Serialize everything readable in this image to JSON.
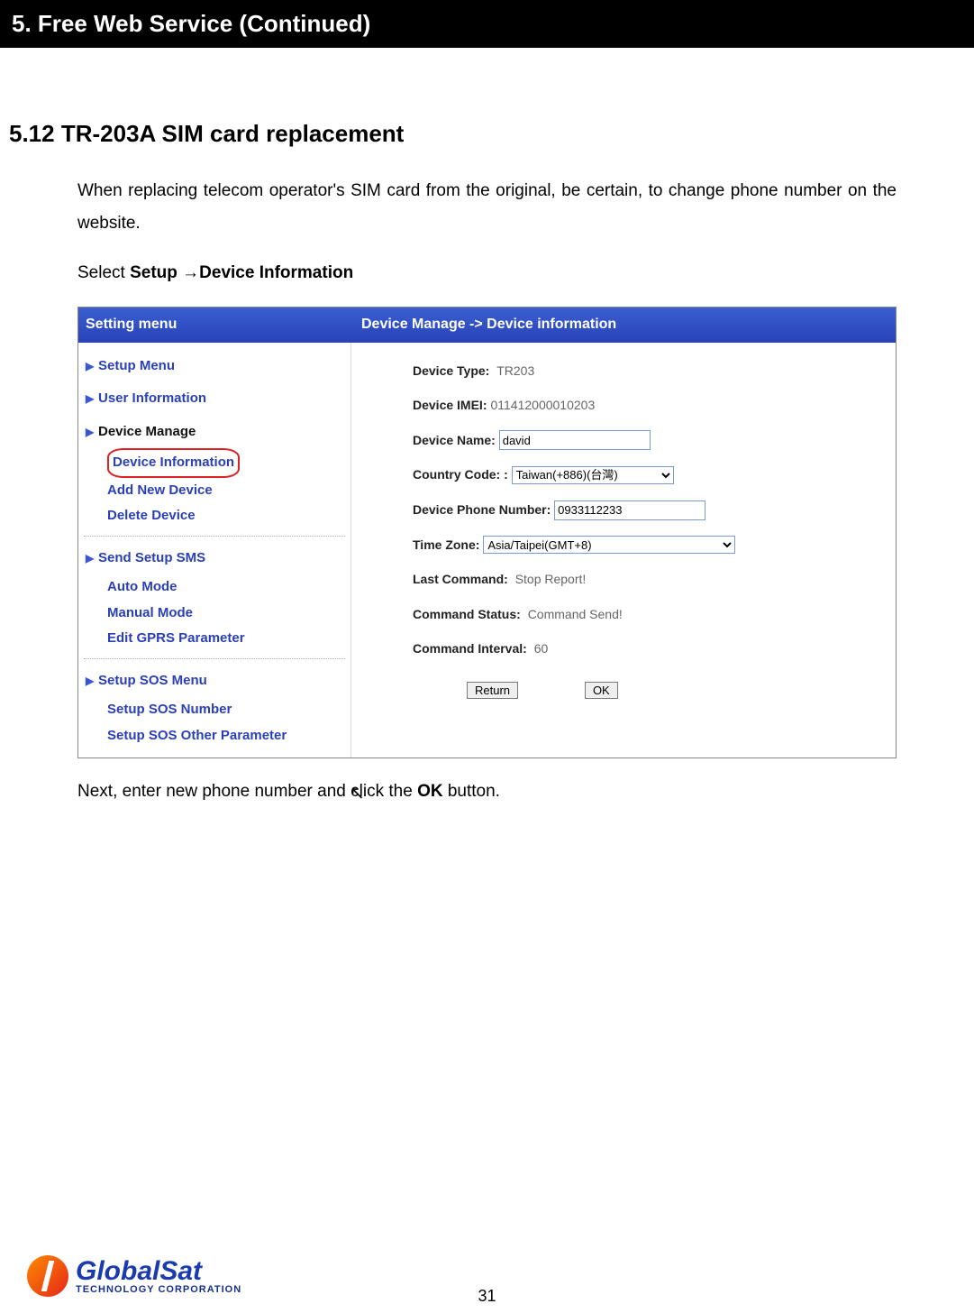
{
  "banner": "5. Free Web Service (Continued)",
  "heading": "5.12 TR-203A SIM card replacement",
  "para1": "When replacing telecom operator's SIM card from the original, be certain, to change phone number on the website.",
  "select_prefix": "Select ",
  "select_bold1": "Setup ",
  "select_arrow": "→",
  "select_bold2": "Device Information",
  "after_para_prefix": "Next, enter new phone number and click the ",
  "after_para_bold": "OK",
  "after_para_suffix": " button.",
  "bluebar_left": "Setting menu",
  "bluebar_right": "Device Manage -> Device information",
  "sidebar": {
    "setup_menu": "Setup Menu",
    "user_info": "User Information",
    "device_manage": "Device Manage",
    "device_info": "Device Information",
    "add_new_device": "Add New Device",
    "delete_device": "Delete Device",
    "send_setup_sms": "Send Setup SMS",
    "auto_mode": "Auto Mode",
    "manual_mode": "Manual Mode",
    "edit_gprs": "Edit GPRS Parameter",
    "setup_sos_menu": "Setup SOS Menu",
    "setup_sos_number": "Setup SOS Number",
    "setup_sos_other": "Setup SOS Other Parameter"
  },
  "form": {
    "device_type_label": "Device Type:",
    "device_type_value": "TR203",
    "device_imei_label": "Device IMEI:",
    "device_imei_value": "011412000010203",
    "device_name_label": "Device Name:",
    "device_name_value": "david",
    "country_code_label": "Country Code: :",
    "country_code_value": "Taiwan(+886)(台灣)",
    "device_phone_label": "Device Phone Number:",
    "device_phone_value": "0933112233",
    "time_zone_label": "Time Zone:",
    "time_zone_value": "Asia/Taipei(GMT+8)",
    "last_command_label": "Last Command:",
    "last_command_value": "Stop Report!",
    "command_status_label": "Command Status:",
    "command_status_value": "Command Send!",
    "command_interval_label": "Command Interval:",
    "command_interval_value": "60",
    "return_btn": "Return",
    "ok_btn": "OK"
  },
  "footer": {
    "page_no": "31",
    "logo_top": "GlobalSat",
    "logo_bot": "TECHNOLOGY CORPORATION"
  }
}
